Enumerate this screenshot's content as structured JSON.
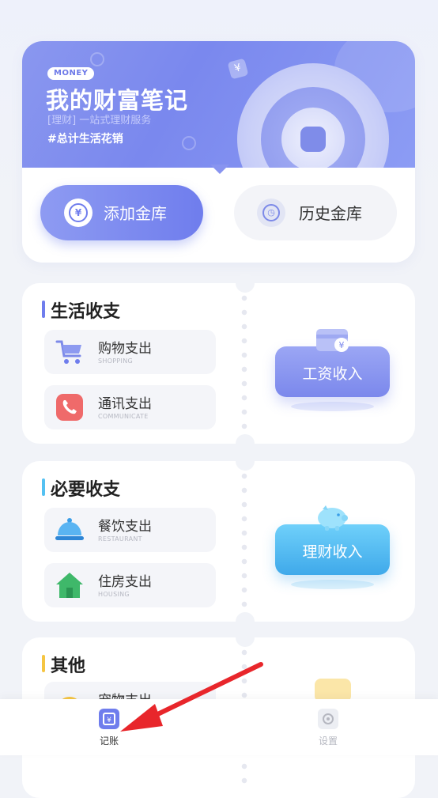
{
  "hero": {
    "badge": "MONEY",
    "title": "我的财富笔记",
    "subtitle": "[理财] 一站式理财服务",
    "tag": "#总计生活花销",
    "add_button": "添加金库",
    "history_button": "历史金库"
  },
  "sections": [
    {
      "title": "生活收支",
      "bar_color": "#6f7ded",
      "items": [
        {
          "name": "购物支出",
          "en": "SHOPPING",
          "icon": "shopping-cart-icon"
        },
        {
          "name": "通讯支出",
          "en": "COMMUNICATE",
          "icon": "phone-icon"
        }
      ],
      "income": {
        "label": "工资收入",
        "icon": "salary-card-icon"
      }
    },
    {
      "title": "必要收支",
      "bar_color": "#54c1f2",
      "items": [
        {
          "name": "餐饮支出",
          "en": "RESTAURANT",
          "icon": "food-cloche-icon"
        },
        {
          "name": "住房支出",
          "en": "HOUSING",
          "icon": "house-icon"
        }
      ],
      "income": {
        "label": "理财收入",
        "icon": "piggy-bank-icon"
      }
    },
    {
      "title": "其他",
      "bar_color": "#f5c542",
      "items": [
        {
          "name": "宠物支出",
          "en": "",
          "icon": "pet-icon"
        }
      ]
    }
  ],
  "tabbar": {
    "tabs": [
      {
        "label": "记账",
        "icon": "ledger-icon",
        "active": true
      },
      {
        "label": "设置",
        "icon": "settings-icon",
        "active": false
      }
    ],
    "active_color": "#6f7ded",
    "inactive_color": "#b5b7c0"
  }
}
